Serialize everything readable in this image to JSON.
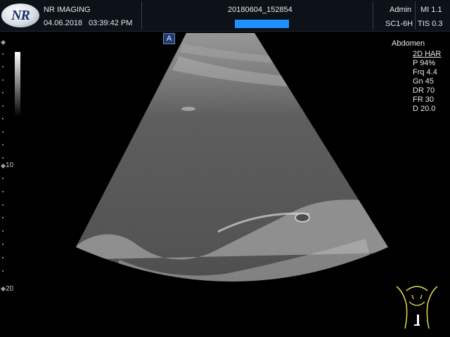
{
  "header": {
    "brand": "NR IMAGING",
    "logo_text": "NR",
    "date": "04.06.2018",
    "time": "03:39:42 PM",
    "study_id": "20180604_152854",
    "user": "Admin",
    "probe": "SC1-6H",
    "mi": "MI 1.1",
    "tis": "TIS 0.3"
  },
  "marker_badge": "A",
  "depth_scale": {
    "mid": "10",
    "bottom": "20"
  },
  "params": {
    "preset": "Abdomen",
    "mode": "2D HAR",
    "power": "P 94%",
    "frequency": "Frq 4.4",
    "gain": "Gn 45",
    "dynamic_range": "DR 70",
    "frame_rate": "FR 30",
    "depth": "D 20.0"
  },
  "icons": {
    "logo": "nr-imaging-logo-icon",
    "orientation": "orientation-marker-icon",
    "bodymark": "abdomen-bodymark-icon"
  },
  "colors": {
    "header_bg": "#0d1118",
    "redaction": "#1e90ff",
    "bodymark": "#e8dc50"
  }
}
